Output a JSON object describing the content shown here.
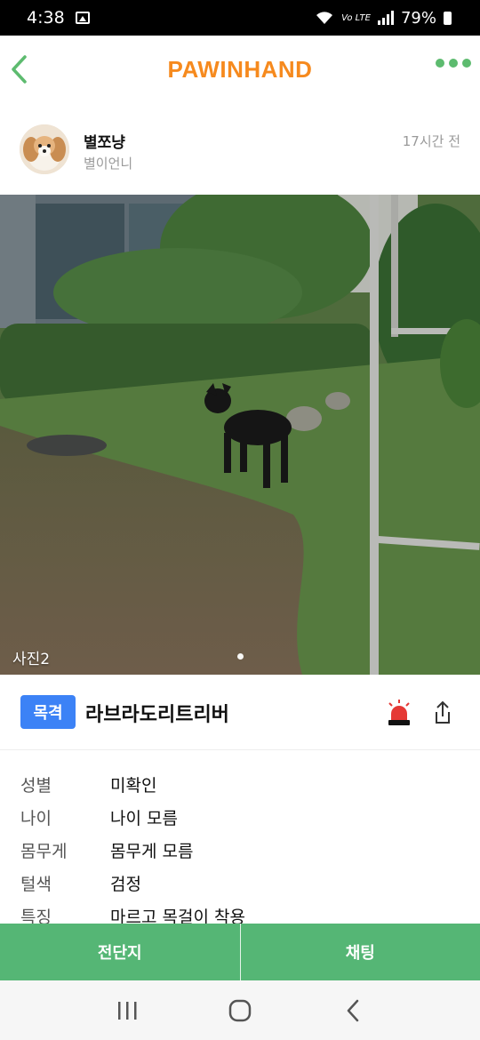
{
  "status_bar": {
    "time": "4:38",
    "network": "Vo LTE",
    "battery": "79%"
  },
  "header": {
    "logo": "PAWINHAND",
    "accent_color": "#f68a1e",
    "green_color": "#5dbb6f"
  },
  "author": {
    "name": "별쪼냥",
    "subtitle": "별이언니",
    "time": "17시간 전"
  },
  "photo": {
    "label": "사진2",
    "page_count": 1,
    "active_page": 1
  },
  "post": {
    "badge": "목격",
    "badge_color": "#3c82f6",
    "title": "라브라도리트리버"
  },
  "info": [
    {
      "key": "성별",
      "value": "미확인"
    },
    {
      "key": "나이",
      "value": "나이 모름"
    },
    {
      "key": "몸무게",
      "value": "몸무게 모름"
    },
    {
      "key": "털색",
      "value": "검정"
    },
    {
      "key": "특징",
      "value": "마르고 목걸이 착용"
    }
  ],
  "bottom_bar": {
    "flyer_label": "전단지",
    "chat_label": "채팅",
    "color": "#55b675"
  },
  "icons": {
    "back": "chevron-left-icon",
    "more": "more-dots-icon",
    "siren": "siren-icon",
    "share": "share-icon"
  }
}
